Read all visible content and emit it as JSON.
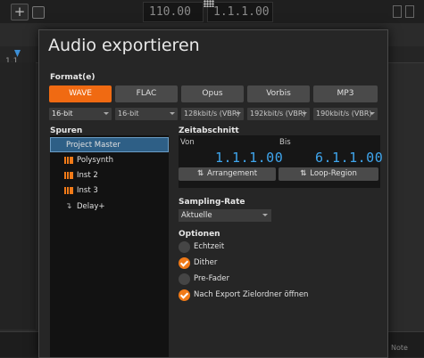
{
  "background": {
    "tempo": "110.00",
    "position": "1.1.1.00",
    "ruler_mark": "1.1",
    "bottom_label": "Note",
    "bottom_label2": "None"
  },
  "dialog": {
    "title": "Audio exportieren",
    "format_label": "Format(e)",
    "formats": [
      {
        "label": "WAVE",
        "active": true
      },
      {
        "label": "FLAC",
        "active": false
      },
      {
        "label": "Opus",
        "active": false
      },
      {
        "label": "Vorbis",
        "active": false
      },
      {
        "label": "MP3",
        "active": false
      }
    ],
    "format_options": [
      "16-bit",
      "16-bit",
      "128kbit/s (VBR)",
      "192kbit/s (VBR)",
      "190kbit/s (VBR)"
    ],
    "tracks_label": "Spuren",
    "tracks": [
      {
        "name": "Project Master",
        "icon": "none",
        "selected": true
      },
      {
        "name": "Polysynth",
        "icon": "piano-icon",
        "selected": false
      },
      {
        "name": "Inst 2",
        "icon": "piano-icon",
        "selected": false
      },
      {
        "name": "Inst 3",
        "icon": "piano-icon",
        "selected": false
      },
      {
        "name": "Delay+",
        "icon": "send-icon",
        "selected": false
      }
    ],
    "zeitabschnitt": {
      "label": "Zeitabschnitt",
      "from_label": "Von",
      "to_label": "Bis",
      "from_value": "1.1.1.00",
      "to_value": "6.1.1.00",
      "btn_arrangement": "Arrangement",
      "btn_loop": "Loop-Region",
      "btn_icon": "⇅"
    },
    "sampling": {
      "label": "Sampling-Rate",
      "value": "Aktuelle"
    },
    "options": {
      "label": "Optionen",
      "items": [
        {
          "label": "Echtzeit",
          "checked": false
        },
        {
          "label": "Dither",
          "checked": true
        },
        {
          "label": "Pre-Fader",
          "checked": false
        },
        {
          "label": "Nach Export Zielordner öffnen",
          "checked": true
        }
      ]
    },
    "accent_color": "#f06a12",
    "value_color": "#3fa6ee"
  }
}
